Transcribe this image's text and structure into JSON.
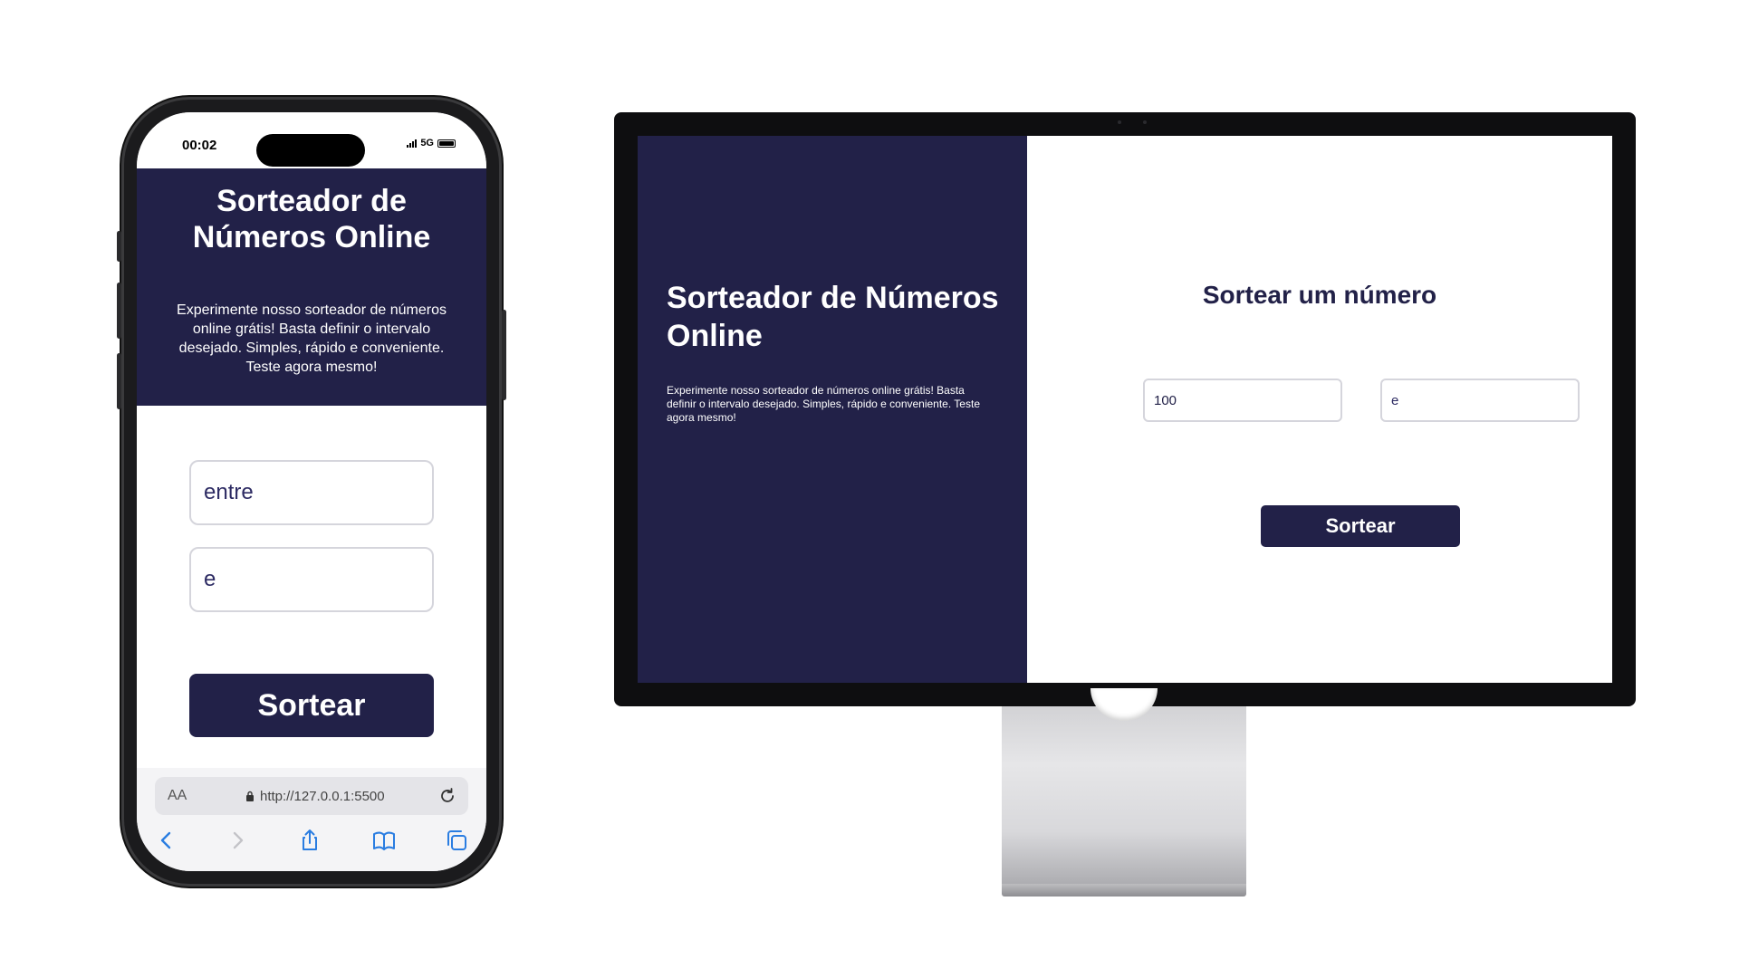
{
  "phone": {
    "status": {
      "time": "00:02",
      "network": "5G"
    },
    "hero": {
      "title": "Sorteador de Números Online",
      "description": "Experimente nosso sorteador de números online grátis! Basta definir o intervalo desejado. Simples, rápido e conveniente. Teste agora mesmo!"
    },
    "form": {
      "min_placeholder": "entre",
      "max_placeholder": "e",
      "button_label": "Sortear"
    },
    "browser": {
      "aa_label": "AA",
      "url": "http://127.0.0.1:5500",
      "icons": [
        "back-icon",
        "forward-icon",
        "share-icon",
        "bookmarks-icon",
        "tabs-icon"
      ]
    }
  },
  "desktop": {
    "hero": {
      "title": "Sorteador de Números Online",
      "description": "Experimente nosso sorteador de números online grátis! Basta definir o intervalo desejado. Simples, rápido e conveniente. Teste agora mesmo!"
    },
    "form": {
      "heading": "Sortear um número",
      "min_value": "100",
      "max_placeholder": "e",
      "button_label": "Sortear"
    }
  },
  "colors": {
    "brand_navy": "#222148",
    "input_border": "#d5d5dc",
    "background": "#ffffff"
  }
}
